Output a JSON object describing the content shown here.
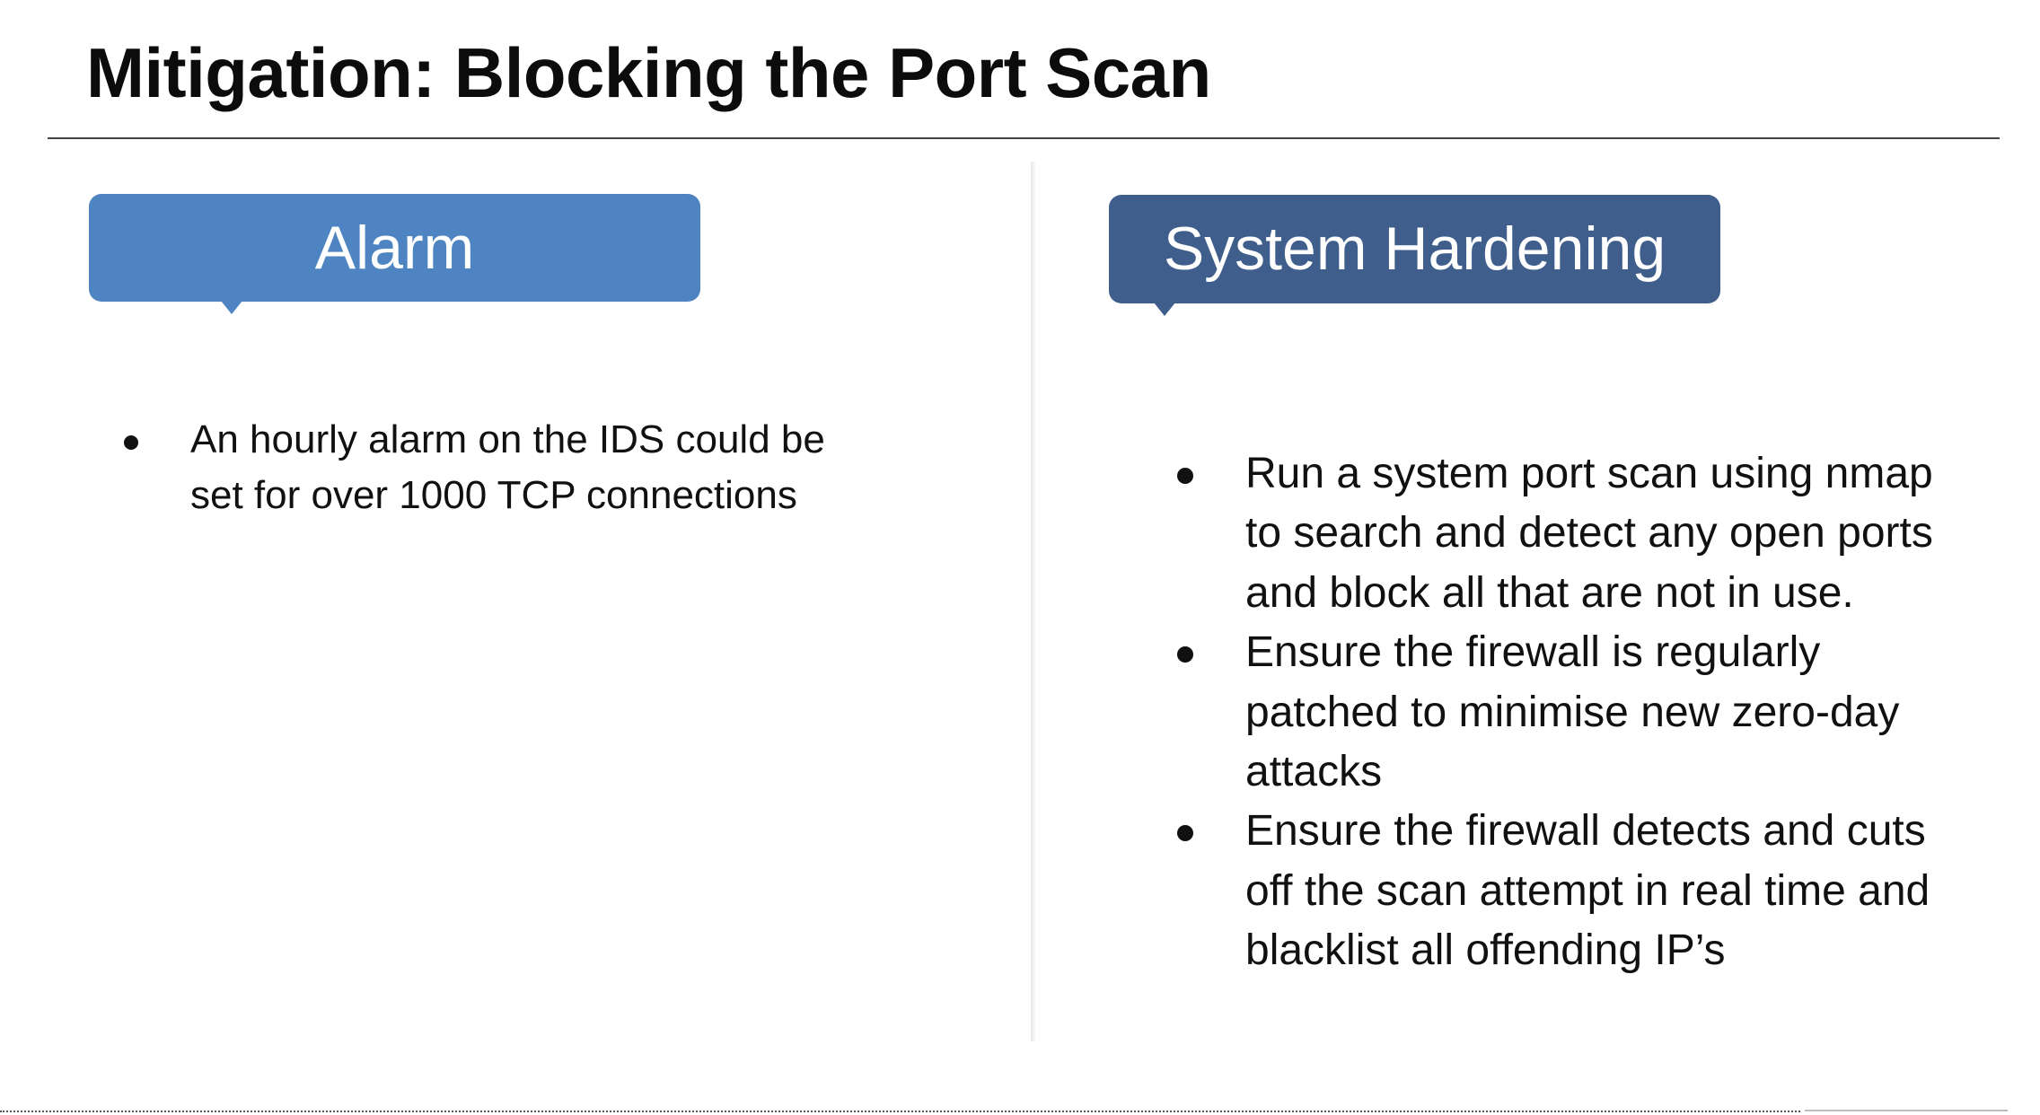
{
  "title": "Mitigation: Blocking the Port Scan",
  "alarm": {
    "heading": "Alarm",
    "color": "#4f84c2",
    "bullets": [
      "An hourly  alarm on the IDS could be set for over 1000 TCP connections"
    ]
  },
  "hardening": {
    "heading": "System Hardening",
    "color": "#3f5e8c",
    "bullets": [
      "Run a system port scan using nmap to search and detect any open ports and block all that are not in use.",
      "Ensure the firewall is regularly patched to minimise new zero-day attacks",
      "Ensure the firewall detects and cuts off the scan attempt in real time and blacklist all offending IP’s"
    ]
  }
}
